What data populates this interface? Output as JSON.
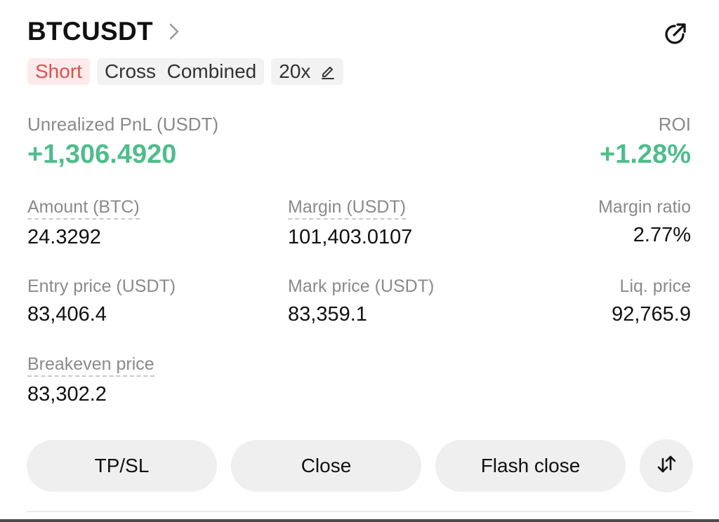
{
  "header": {
    "symbol": "BTCUSDT",
    "chevron_icon": "chevron-right-icon",
    "share_icon": "share-icon"
  },
  "tags": {
    "side": "Short",
    "margin_mode": "Cross  Combined",
    "leverage": "20x",
    "edit_icon": "edit-icon"
  },
  "pnl": {
    "label": "Unrealized PnL (USDT)",
    "value": "+1,306.4920",
    "roi_label": "ROI",
    "roi_value": "+1.28%"
  },
  "stats": {
    "amount": {
      "label": "Amount (BTC)",
      "value": "24.3292"
    },
    "margin": {
      "label": "Margin (USDT)",
      "value": "101,403.0107"
    },
    "margin_ratio": {
      "label": "Margin ratio",
      "value": "2.77%"
    },
    "entry_price": {
      "label": "Entry price (USDT)",
      "value": "83,406.4"
    },
    "mark_price": {
      "label": "Mark price (USDT)",
      "value": "83,359.1"
    },
    "liq_price": {
      "label": "Liq. price",
      "value": "92,765.9"
    },
    "breakeven_price": {
      "label": "Breakeven price",
      "value": "83,302.2"
    }
  },
  "actions": {
    "tpsl": "TP/SL",
    "close": "Close",
    "flash_close": "Flash close",
    "swap_icon": "reverse-position-icon"
  },
  "colors": {
    "profit": "#4fbd8c",
    "short": "#d9534f",
    "short_bg": "#fdeaea",
    "muted": "#8a8a8a",
    "button_bg": "#efefef"
  }
}
